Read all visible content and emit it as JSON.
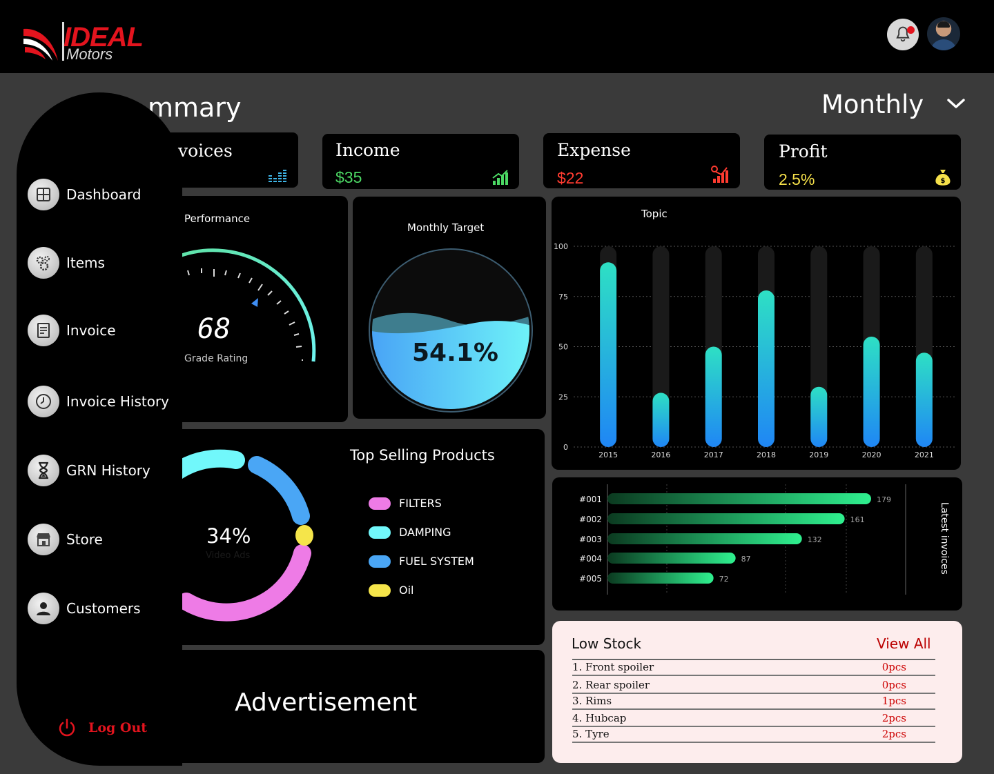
{
  "brand": {
    "name_top": "IDEAL",
    "name_bottom": "Motors"
  },
  "page": {
    "title": "Summary",
    "title_visible": "mmary",
    "period": "Monthly"
  },
  "colors": {
    "accent_red": "#e3141e",
    "income_green": "#4cd964",
    "expense_red": "#ff3b30",
    "profit_yellow": "#f5e04a"
  },
  "stats": {
    "invoices": {
      "label": "Invoices",
      "label_visible": "voices",
      "icon": "equalizer-icon"
    },
    "income": {
      "label": "Income",
      "value": "$35",
      "icon": "chart-up-icon"
    },
    "expense": {
      "label": "Expense",
      "value": "$22",
      "icon": "expense-chart-icon"
    },
    "profit": {
      "label": "Profit",
      "value": "2.5%",
      "icon": "money-bag-icon"
    }
  },
  "sidebar": {
    "items": [
      {
        "label": "Dashboard",
        "icon": "dashboard-icon"
      },
      {
        "label": "Items",
        "icon": "gears-icon"
      },
      {
        "label": "Invoice",
        "icon": "invoice-icon"
      },
      {
        "label": "Invoice History",
        "icon": "clock-icon"
      },
      {
        "label": "GRN History",
        "icon": "hourglass-icon"
      },
      {
        "label": "Store",
        "icon": "store-icon"
      },
      {
        "label": "Customers",
        "icon": "user-icon"
      }
    ],
    "logout": "Log Out"
  },
  "performance": {
    "title": "Performance",
    "value": "68",
    "caption": "Grade Rating",
    "fraction": 0.68
  },
  "monthly_target": {
    "title": "Monthly Target",
    "value": "54.1%",
    "fraction": 0.541
  },
  "top_selling": {
    "title": "Top Selling Products",
    "center_value": "34%",
    "center_caption": "Video Ads",
    "legend": [
      {
        "label": "FILTERS",
        "color": "#ee7be6"
      },
      {
        "label": "DAMPING",
        "color": "#71f8fb"
      },
      {
        "label": "FUEL SYSTEM",
        "color": "#4aa6f5"
      },
      {
        "label": "Oil",
        "color": "#f5e54a"
      }
    ]
  },
  "advertisement": {
    "label": "Advertisement"
  },
  "chart_data": [
    {
      "type": "bar",
      "title": "Topic",
      "categories": [
        "2015",
        "2016",
        "2017",
        "2018",
        "2019",
        "2020",
        "2021"
      ],
      "values": [
        92,
        27,
        50,
        78,
        30,
        55,
        47
      ],
      "ylim": [
        0,
        100
      ],
      "yticks": [
        "100",
        "75",
        "50",
        "25",
        "0"
      ],
      "grid": true
    },
    {
      "type": "bar",
      "orientation": "horizontal",
      "title": "Latest invoices",
      "categories": [
        "#001",
        "#002",
        "#003",
        "#004",
        "#005"
      ],
      "values": [
        179,
        161,
        132,
        87,
        72
      ],
      "value_labels": [
        "179",
        "161",
        "132",
        "87",
        "72"
      ]
    }
  ],
  "low_stock": {
    "title": "Low Stock",
    "view_all": "View All",
    "rows": [
      {
        "name": "1. Front spoiler",
        "qty": "0pcs"
      },
      {
        "name": "2. Rear spoiler",
        "qty": "0pcs"
      },
      {
        "name": "3. Rims",
        "qty": "1pcs"
      },
      {
        "name": "4. Hubcap",
        "qty": "2pcs"
      },
      {
        "name": "5. Tyre",
        "qty": "2pcs"
      }
    ]
  }
}
